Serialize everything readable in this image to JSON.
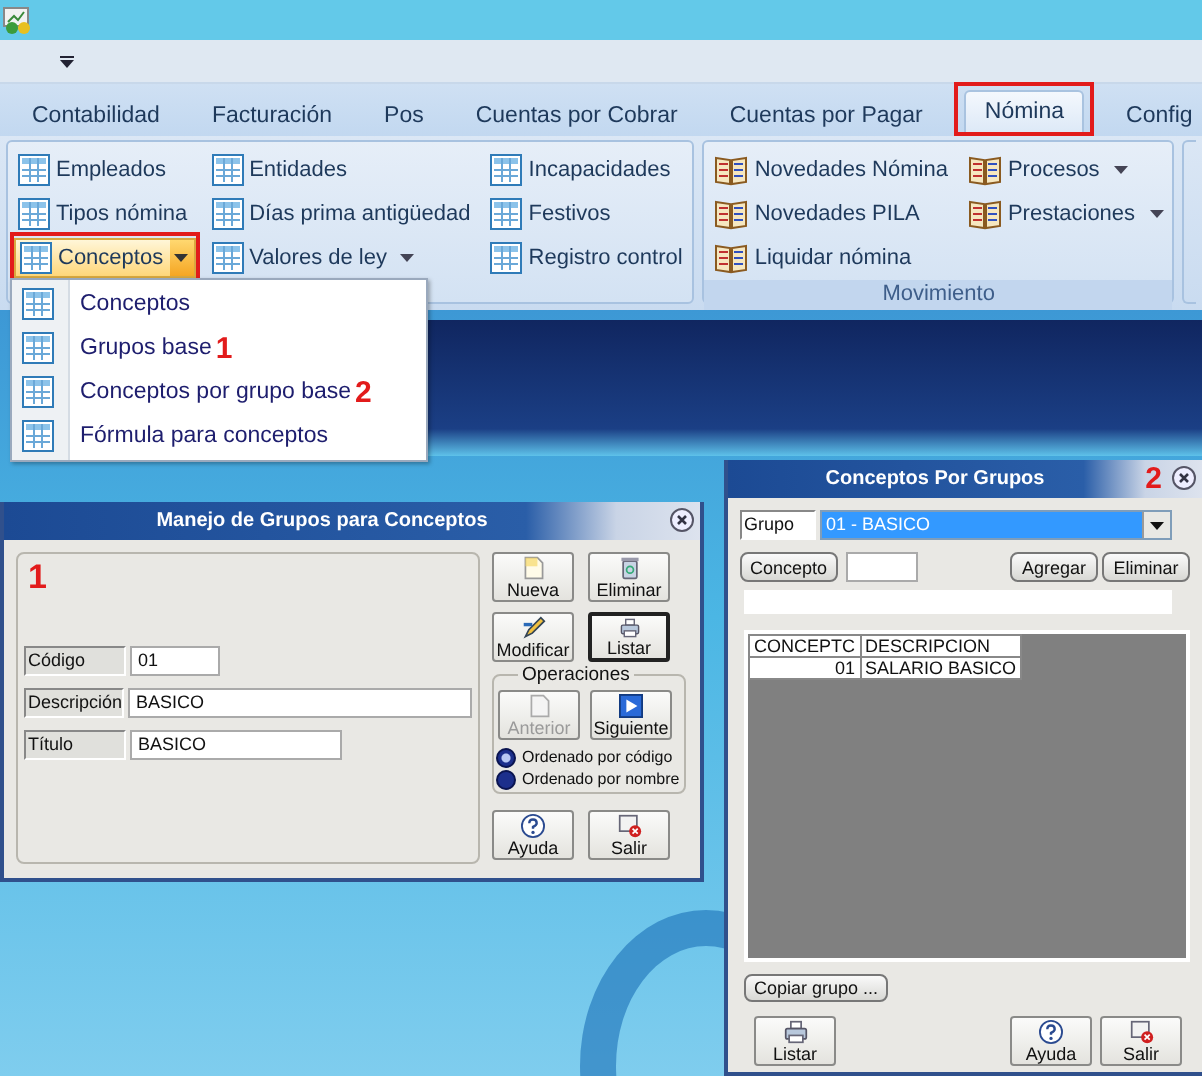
{
  "tabs": [
    {
      "label": "Contabilidad",
      "selected": false,
      "highlighted": false
    },
    {
      "label": "Facturación",
      "selected": false,
      "highlighted": false
    },
    {
      "label": "Pos",
      "selected": false,
      "highlighted": false
    },
    {
      "label": "Cuentas por Cobrar",
      "selected": false,
      "highlighted": false
    },
    {
      "label": "Cuentas por Pagar",
      "selected": false,
      "highlighted": false
    },
    {
      "label": "Nómina",
      "selected": true,
      "highlighted": true
    },
    {
      "label": "Config",
      "selected": false,
      "highlighted": false
    }
  ],
  "ribbon": {
    "groups": [
      {
        "columns": [
          [
            {
              "label": "Empleados",
              "kind": "button"
            },
            {
              "label": "Tipos nómina",
              "kind": "button"
            },
            {
              "label": "Conceptos",
              "kind": "split",
              "open": true,
              "highlighted": true
            }
          ],
          [
            {
              "label": "Entidades",
              "kind": "button"
            },
            {
              "label": "Días prima antigüedad",
              "kind": "button"
            },
            {
              "label": "Valores de ley",
              "kind": "dropdown"
            }
          ],
          [
            {
              "label": "Incapacidades",
              "kind": "button"
            },
            {
              "label": "Festivos",
              "kind": "button"
            },
            {
              "label": "Registro control",
              "kind": "button"
            }
          ]
        ]
      },
      {
        "label": "Movimiento",
        "columns": [
          [
            {
              "label": "Novedades Nómina",
              "kind": "button"
            },
            {
              "label": "Novedades PILA",
              "kind": "button"
            },
            {
              "label": "Liquidar nómina",
              "kind": "button"
            }
          ],
          [
            {
              "label": "Procesos",
              "kind": "dropdown"
            },
            {
              "label": "Prestaciones",
              "kind": "dropdown"
            }
          ]
        ]
      }
    ]
  },
  "menu": {
    "items": [
      {
        "label": "Conceptos"
      },
      {
        "label": "Grupos base",
        "annotation": "1"
      },
      {
        "label": "Conceptos por grupo base",
        "annotation": "2"
      },
      {
        "label": "Fórmula para conceptos"
      }
    ]
  },
  "groups_dialog": {
    "title": "Manejo de Grupos para Conceptos",
    "annotation": "1",
    "fields": [
      {
        "label": "Código",
        "value": "01"
      },
      {
        "label": "Descripción",
        "value": "BASICO"
      },
      {
        "label": "Título",
        "value": "BASICO"
      }
    ],
    "buttons": [
      {
        "label": "Nueva",
        "kind": "new",
        "focused": false
      },
      {
        "label": "Eliminar",
        "kind": "delete",
        "focused": false
      },
      {
        "label": "Modificar",
        "kind": "edit",
        "focused": false
      },
      {
        "label": "Listar",
        "kind": "print",
        "focused": true
      }
    ],
    "operations": {
      "label": "Operaciones",
      "buttons": [
        {
          "label": "Anterior",
          "kind": "page",
          "disabled": true
        },
        {
          "label": "Siguiente",
          "kind": "next",
          "disabled": false
        }
      ],
      "sort_options": [
        {
          "label": "Ordenado por código",
          "selected": true
        },
        {
          "label": "Ordenado por nombre",
          "selected": false
        }
      ]
    },
    "footer_buttons": [
      {
        "label": "Ayuda",
        "kind": "help"
      },
      {
        "label": "Salir",
        "kind": "exit"
      }
    ]
  },
  "concepts_dialog": {
    "title": "Conceptos Por Grupos",
    "annotation": "2",
    "group": {
      "label": "Grupo",
      "value": "01 - BASICO"
    },
    "concept_button": "Concepto",
    "actions": [
      "Agregar",
      "Eliminar"
    ],
    "table": {
      "columns": [
        "CONCEPTC",
        "DESCRIPCION"
      ],
      "rows": [
        [
          "01",
          "SALARIO BASICO"
        ]
      ]
    },
    "copy_button": "Copiar grupo ...",
    "footer_buttons": [
      {
        "label": "Listar",
        "kind": "print"
      },
      {
        "label": "Ayuda",
        "kind": "help"
      },
      {
        "label": "Salir",
        "kind": "exit"
      }
    ]
  }
}
